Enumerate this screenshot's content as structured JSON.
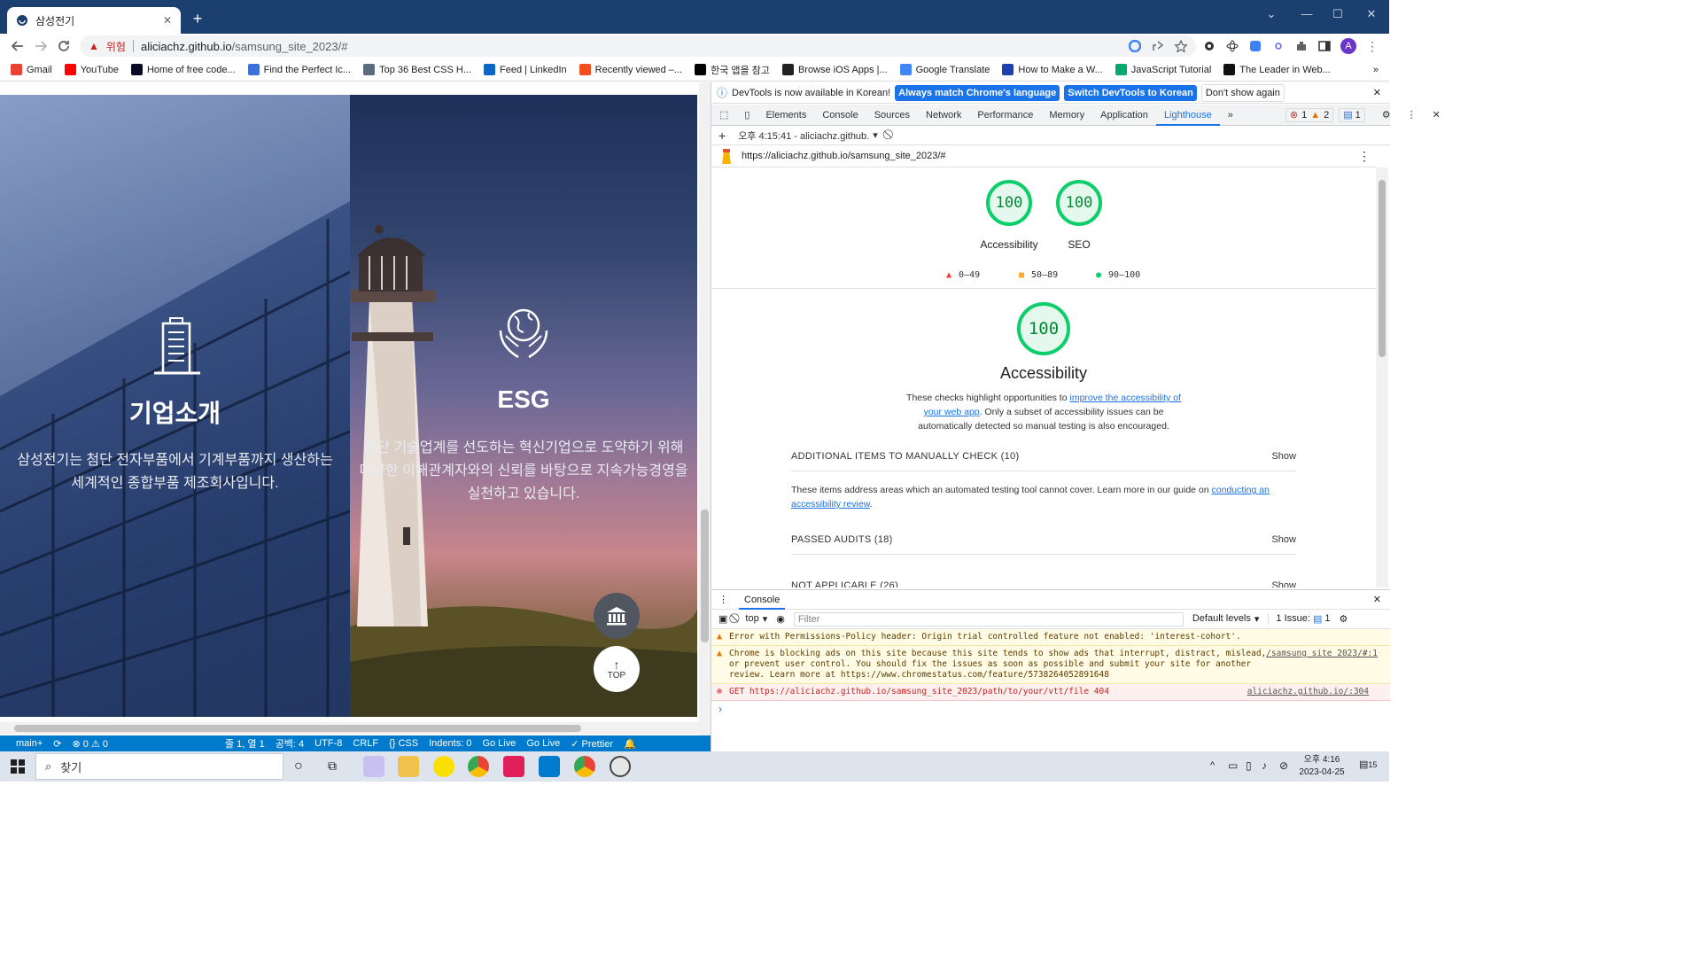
{
  "browser": {
    "tab_title": "삼성전기",
    "new_tab": "+",
    "security_warning": "위험",
    "url_host": "aliciachz.github.io",
    "url_path": "/samsung_site_2023/#",
    "profile_initial": "A"
  },
  "bookmarks": [
    {
      "label": "Gmail",
      "color": "#ea4335"
    },
    {
      "label": "YouTube",
      "color": "#ff0000"
    },
    {
      "label": "Home of free code...",
      "color": "#0a0a23"
    },
    {
      "label": "Find the Perfect Ic...",
      "color": "#3f6fd8"
    },
    {
      "label": "Top 36 Best CSS H...",
      "color": "#5b6b7c"
    },
    {
      "label": "Feed | LinkedIn",
      "color": "#0a66c2"
    },
    {
      "label": "Recently viewed –...",
      "color": "#f24e1e"
    },
    {
      "label": "한국 앱을 참고",
      "color": "#000000"
    },
    {
      "label": "Browse iOS Apps |...",
      "color": "#222222"
    },
    {
      "label": "Google Translate",
      "color": "#4285f4"
    },
    {
      "label": "How to Make a W...",
      "color": "#1e40af"
    },
    {
      "label": "JavaScript Tutorial",
      "color": "#04aa6d"
    },
    {
      "label": "The Leader in Web...",
      "color": "#111111"
    }
  ],
  "page": {
    "left_title": "기업소개",
    "left_text_1": "삼성전기는 첨단 전자부품에서 기계부품까지 생산하는",
    "left_text_2": "세계적인 종합부품 제조회사입니다.",
    "right_title": "ESG",
    "right_text_1": "첨단 기술업계를 선도하는 혁신기업으로 도약하기 위해",
    "right_text_2": "다양한 이해관계자와의 신뢰를 바탕으로 지속가능경영을",
    "right_text_3": "실천하고 있습니다.",
    "top_label": "TOP"
  },
  "statusbar": {
    "branch": "main+",
    "problems": "⊗ 0 ⚠ 0",
    "position": "줄 1, 열 1",
    "spaces": "공백: 4",
    "encoding": "UTF-8",
    "eol": "CRLF",
    "language": "{} CSS",
    "indents": "Indents: 0",
    "golive1": "Go Live",
    "golive2": "Go Live",
    "prettier": "✓ Prettier"
  },
  "devtools": {
    "info_message": "DevTools is now available in Korean!",
    "info_btn_match": "Always match Chrome's language",
    "info_btn_switch": "Switch DevTools to Korean",
    "info_btn_dismiss": "Don't show again",
    "tabs": [
      "Elements",
      "Console",
      "Sources",
      "Network",
      "Performance",
      "Memory",
      "Application",
      "Lighthouse"
    ],
    "active_tab": "Lighthouse",
    "errors": "1",
    "warnings": "2",
    "messages": "1",
    "report_time": "오후 4:15:41 - aliciachz.github.",
    "report_url": "https://aliciachz.github.io/samsung_site_2023/#"
  },
  "lighthouse": {
    "scores": [
      {
        "label": "Accessibility",
        "value": "100"
      },
      {
        "label": "SEO",
        "value": "100"
      }
    ],
    "legend": [
      "0–49",
      "50–89",
      "90–100"
    ],
    "legend_colors": [
      "#ff3333",
      "#ffaa33",
      "#0cce6b"
    ],
    "main_score": "100",
    "main_label": "Accessibility",
    "desc_1": "These checks highlight opportunities to ",
    "desc_link": "improve the accessibility of your web app",
    "desc_2": ". Only a subset of accessibility issues can be automatically detected so manual testing is also encouraged.",
    "section_manual": "ADDITIONAL ITEMS TO MANUALLY CHECK (10)",
    "manual_desc": "These items address areas which an automated testing tool cannot cover. Learn more in our guide on ",
    "manual_link": "conducting an accessibility review",
    "section_passed": "PASSED AUDITS (18)",
    "section_na": "NOT APPLICABLE (26)",
    "show": "Show"
  },
  "console": {
    "tab": "Console",
    "context": "top",
    "filter_placeholder": "Filter",
    "levels": "Default levels",
    "issues": "1 Issue: ",
    "issues_count": "1",
    "msg1": "Error with Permissions-Policy header: Origin trial controlled feature not enabled: 'interest-cohort'.",
    "msg2": "Chrome is blocking ads on this site because this site tends to show ads that interrupt, distract, mislead, or prevent user control. You should fix the issues as soon as possible and submit your site for another review. Learn more at https://www.chromestatus.com/feature/5738264052891648",
    "msg2_src": "/samsung site 2023/#:1",
    "msg3": "GET https://aliciachz.github.io/samsung_site_2023/path/to/your/vtt/file 404",
    "msg3_src": "aliciachz.github.io/:304",
    "prompt": "›"
  },
  "taskbar": {
    "search_placeholder": "찾기",
    "time": "오후 4:16",
    "date": "2023-04-25",
    "notifications": "15"
  }
}
